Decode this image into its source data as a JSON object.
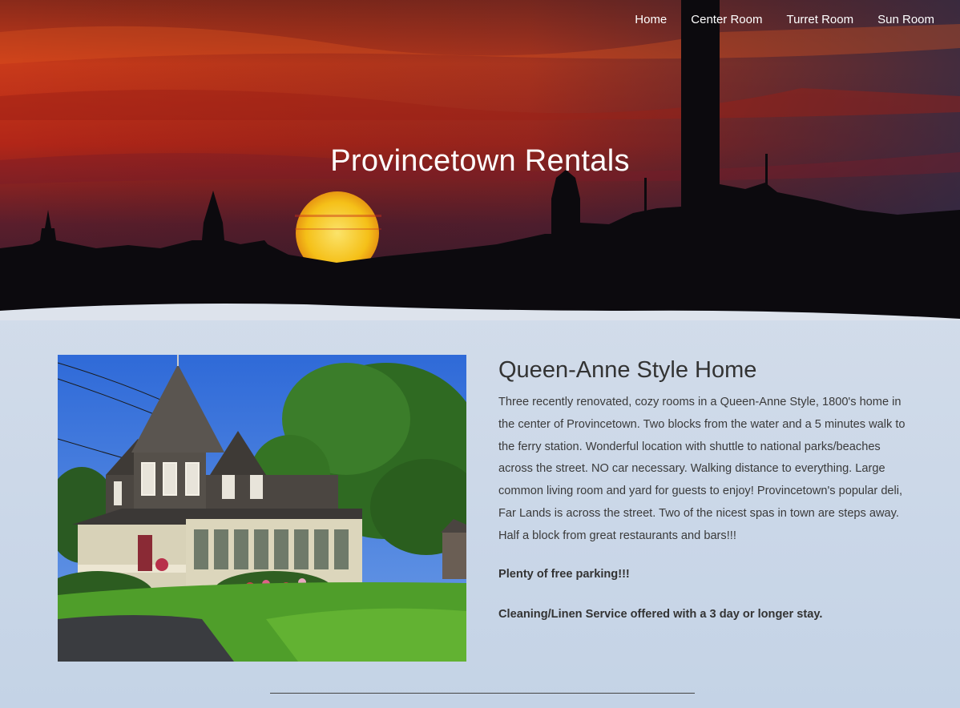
{
  "nav": {
    "items": [
      {
        "label": "Home"
      },
      {
        "label": "Center Room"
      },
      {
        "label": "Turret Room"
      },
      {
        "label": "Sun Room"
      }
    ]
  },
  "hero": {
    "title": "Provincetown Rentals"
  },
  "main": {
    "heading": "Queen-Anne Style Home",
    "description": "Three recently renovated, cozy rooms in a Queen-Anne Style, 1800's home in the center of Provincetown. Two blocks from the water and a 5 minutes walk to the ferry station. Wonderful location with shuttle to national parks/beaches across the street. NO car necessary. Walking distance to everything. Large common living room and yard for guests to enjoy! Provincetown's popular deli, Far Lands is across the street. Two of the nicest spas in town are steps away. Half a block from great restaurants and bars!!!",
    "parking": "Plenty of free parking!!!",
    "cleaning": "Cleaning/Linen Service offered with a 3 day or longer stay."
  },
  "colors": {
    "sky_top": "#2a1e3a",
    "sky_red": "#c8301a",
    "sun": "#f5c018",
    "page_bg": "#cfdae9",
    "text": "#333333"
  }
}
